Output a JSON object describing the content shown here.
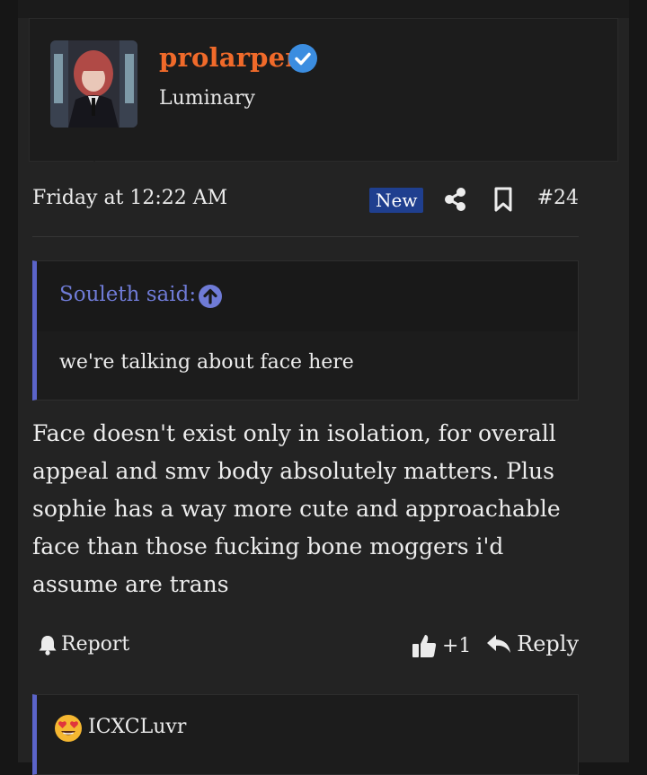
{
  "user": {
    "name": "prolarper",
    "title": "Luminary",
    "verified": true
  },
  "post": {
    "date": "Friday at 12:22 AM",
    "badge": "New",
    "number": "#24",
    "quote": {
      "author": "Souleth said:",
      "text": "we're talking about face here"
    },
    "body_lines": [
      "Face doesn't exist only in isolation, for overall",
      "appeal and smv body absolutely matters. Plus",
      "sophie has a way more cute and approachable",
      "face than those fucking bone moggers i'd",
      "assume are trans"
    ]
  },
  "actions": {
    "report": "Report",
    "like": "+1",
    "reply": "Reply"
  },
  "reactions": {
    "user": "ICXCLuvr",
    "emoji": "heart-eyes-emoji-icon"
  },
  "colors": {
    "username": "#f06a2a",
    "accent": "#5b64c9",
    "badge": "#1f3f8f",
    "verified": "#3b8de0"
  }
}
